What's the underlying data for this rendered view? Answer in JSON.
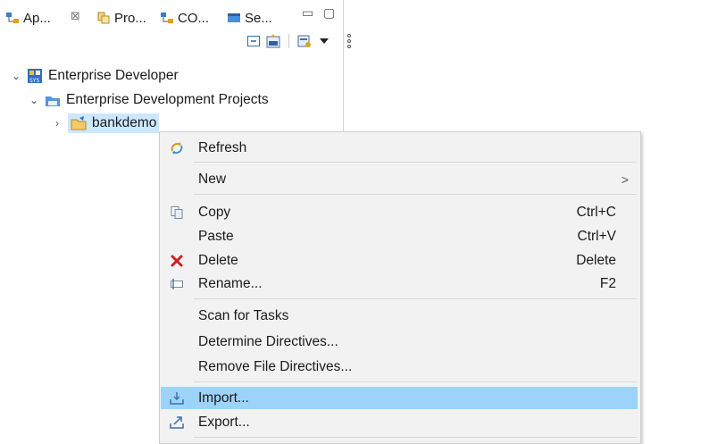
{
  "tabs": [
    {
      "label": "Ap...",
      "icon": "application-explorer-icon"
    },
    {
      "label": "Pro...",
      "icon": "project-explorer-icon"
    },
    {
      "label": "CO...",
      "icon": "cobol-explorer-icon"
    },
    {
      "label": "Se...",
      "icon": "server-explorer-icon"
    }
  ],
  "tab_close_glyph": "⊠",
  "window_controls": {
    "minimize": "▭",
    "maximize": "▢"
  },
  "tree": {
    "root": {
      "label": "Enterprise Developer",
      "icon": "enterprise-developer-icon",
      "expanded": true
    },
    "group": {
      "label": "Enterprise Development Projects",
      "icon": "projects-folder-icon",
      "expanded": true
    },
    "project": {
      "label": "bankdemo",
      "icon": "project-folder-icon",
      "expanded": false,
      "selected": true
    }
  },
  "context_menu": {
    "items": [
      {
        "label": "Refresh",
        "icon": "refresh-icon",
        "accelerator": ""
      },
      {
        "label": "New",
        "icon": "",
        "accelerator": "",
        "submenu_glyph": ">"
      },
      {
        "label": "Copy",
        "icon": "copy-icon",
        "accelerator": "Ctrl+C"
      },
      {
        "label": "Paste",
        "icon": "",
        "accelerator": "Ctrl+V"
      },
      {
        "label": "Delete",
        "icon": "delete-icon",
        "accelerator": "Delete"
      },
      {
        "label": "Rename...",
        "icon": "rename-icon",
        "accelerator": "F2"
      },
      {
        "label": "Scan for Tasks",
        "icon": "",
        "accelerator": ""
      },
      {
        "label": "Determine Directives...",
        "icon": "",
        "accelerator": ""
      },
      {
        "label": "Remove File Directives...",
        "icon": "",
        "accelerator": ""
      },
      {
        "label": "Import...",
        "icon": "import-icon",
        "accelerator": "",
        "highlighted": true
      },
      {
        "label": "Export...",
        "icon": "export-icon",
        "accelerator": ""
      }
    ]
  },
  "colors": {
    "selection": "#cce8ff",
    "menu_highlight": "#9cd3f8",
    "menu_bg": "#f2f2f2",
    "delete_red": "#d02020"
  }
}
